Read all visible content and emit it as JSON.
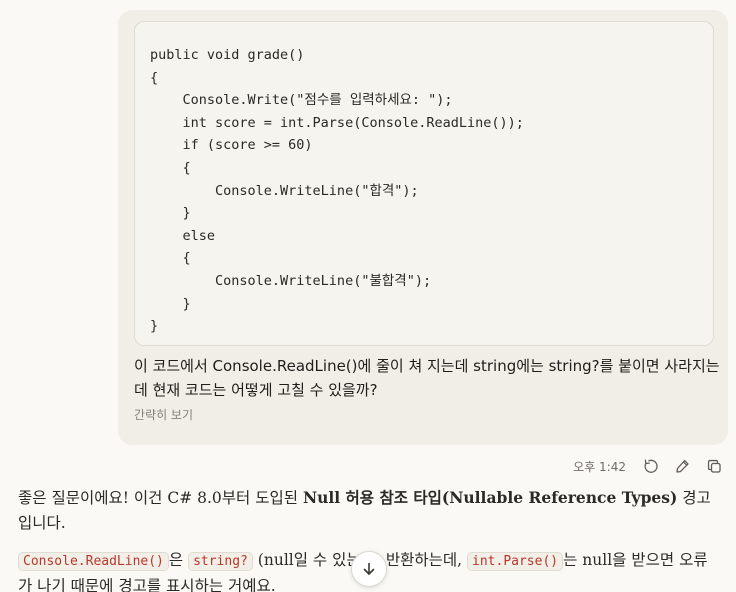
{
  "user_message": {
    "code_lines": [
      "public void grade()",
      "{",
      "    Console.Write(\"점수를 입력하세요: \");",
      "    int score = int.Parse(Console.ReadLine());",
      "    if (score >= 60)",
      "    {",
      "        Console.WriteLine(\"합격\");",
      "    }",
      "    else",
      "    {",
      "        Console.WriteLine(\"불합격\");",
      "    }",
      "}"
    ],
    "text": "이 코드에서 Console.ReadLine()에 줄이 쳐 지는데 string에는 string?를 붙이면 사라지는데 현재 코드는 어떻게 고칠 수 있을까?",
    "collapse_label": "간략히 보기"
  },
  "toolbar": {
    "timestamp": "오후 1:42",
    "icons": [
      "retry-icon",
      "edit-icon",
      "copy-icon"
    ]
  },
  "assistant": {
    "p1_intro": "좋은 질문이에요! 이건 C# 8.0부터 도입된 ",
    "p1_bold": "Null 허용 참조 타입(Nullable Reference Types)",
    "p1_outro": " 경고입니다.",
    "p2_code1": "Console.ReadLine()",
    "p2_t1": "은 ",
    "p2_code2": "string?",
    "p2_t2": " (null일 수 있는)을 반환하는데, ",
    "p2_code3": "int.Parse()",
    "p2_t3": "는 null을 받으면 오류가 나기 때문에 경고를 표시하는 거예요."
  },
  "scroll_button": {
    "icon": "arrow-down-icon"
  }
}
